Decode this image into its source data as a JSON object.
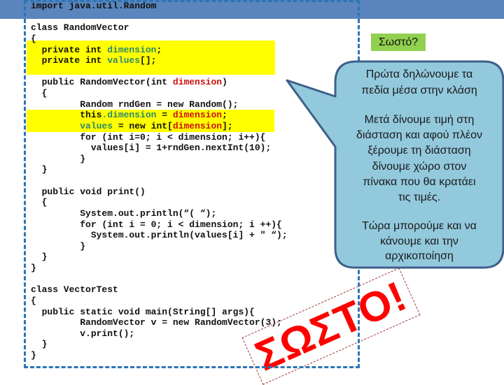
{
  "colors": {
    "header_band": "#5a85bd",
    "highlight": "#ffff00",
    "field_token": "#2f8a6a",
    "param_token": "#cc1111",
    "frame_dash": "#2e75b6",
    "badge_bg": "#92d050",
    "callout_fill": "#93c9dd",
    "callout_stroke": "#3d6089",
    "stamp": "#ff0000"
  },
  "code": {
    "lines": [
      [
        {
          "t": "import java.util.Random"
        }
      ],
      [],
      [
        {
          "t": "class RandomVector"
        }
      ],
      [
        {
          "t": "{"
        }
      ],
      [
        {
          "t": "  private int "
        },
        {
          "t": "dimension",
          "c": "field"
        },
        {
          "t": ";"
        }
      ],
      [
        {
          "t": "  private int "
        },
        {
          "t": "values",
          "c": "field"
        },
        {
          "t": "[];"
        }
      ],
      [],
      [
        {
          "t": "  public RandomVector(int "
        },
        {
          "t": "dimension",
          "c": "param"
        },
        {
          "t": ")"
        }
      ],
      [
        {
          "t": "  {"
        }
      ],
      [
        {
          "t": "         Random rndGen = new Random();"
        }
      ],
      [
        {
          "t": "         this"
        },
        {
          "t": ".dimension",
          "c": "field"
        },
        {
          "t": " = "
        },
        {
          "t": "dimension",
          "c": "param"
        },
        {
          "t": ";"
        }
      ],
      [
        {
          "t": "         "
        },
        {
          "t": "values",
          "c": "field"
        },
        {
          "t": " = new int["
        },
        {
          "t": "dimension",
          "c": "param"
        },
        {
          "t": "];"
        }
      ],
      [
        {
          "t": "         for (int i=0; i < dimension; i++){"
        }
      ],
      [
        {
          "t": "           values[i] = 1+rndGen.nextInt(10);"
        }
      ],
      [
        {
          "t": "         }"
        }
      ],
      [
        {
          "t": "  }"
        }
      ],
      [],
      [
        {
          "t": "  public void print()"
        }
      ],
      [
        {
          "t": "  {"
        }
      ],
      [
        {
          "t": "         System.out.println(“( “);"
        }
      ],
      [
        {
          "t": "         for (int i = 0; i < dimension; i ++){"
        }
      ],
      [
        {
          "t": "           System.out.println(values[i] + \" “);"
        }
      ],
      [
        {
          "t": "         }"
        }
      ],
      [
        {
          "t": "  }"
        }
      ],
      [
        {
          "t": "}"
        }
      ],
      [],
      [
        {
          "t": "class VectorTest"
        }
      ],
      [
        {
          "t": "{"
        }
      ],
      [
        {
          "t": "  public static void main(String[] args){"
        }
      ],
      [
        {
          "t": "         RandomVector v = new RandomVector(3);"
        }
      ],
      [
        {
          "t": "         v.print();"
        }
      ],
      [
        {
          "t": "  }"
        }
      ],
      [
        {
          "t": "}"
        }
      ]
    ]
  },
  "badge": {
    "label": "Σωστό?"
  },
  "callout": {
    "lines": [
      "Πρώτα δηλώνουμε τα",
      "πεδία μέσα στην κλάση",
      "Μετά δίνουμε τιμή στη",
      "διάσταση και αφού πλέον",
      "ξέρουμε τη διάσταση",
      "δίνουμε χώρο στον",
      "πίνακα που θα κρατάει",
      "τις τιμές.",
      "Τώρα μπορούμε και να",
      "κάνουμε και την",
      "αρχικοποίηση"
    ]
  },
  "stamp": {
    "text": "ΣΩΣΤΟ!"
  }
}
